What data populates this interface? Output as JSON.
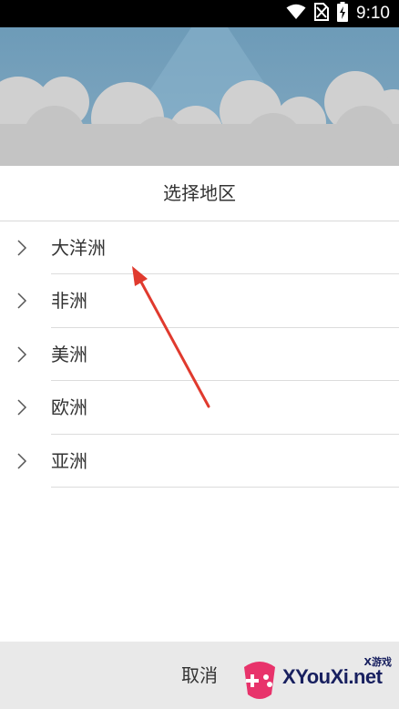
{
  "status_bar": {
    "time": "9:10",
    "icons": [
      "wifi-icon",
      "no-sim-icon",
      "battery-charging-icon"
    ]
  },
  "dialog": {
    "title": "选择地区",
    "regions": [
      {
        "label": "大洋洲",
        "icon": "chevron-right-icon"
      },
      {
        "label": "非洲",
        "icon": "chevron-right-icon"
      },
      {
        "label": "美洲",
        "icon": "chevron-right-icon"
      },
      {
        "label": "欧洲",
        "icon": "chevron-right-icon"
      },
      {
        "label": "亚洲",
        "icon": "chevron-right-icon"
      }
    ],
    "cancel_label": "取消"
  },
  "annotation": {
    "type": "arrow",
    "color": "#e03a2e"
  },
  "watermark": {
    "brand": "XYouXi.net",
    "sub": "X游戏"
  },
  "colors": {
    "status_bar": "#000000",
    "sky": "#7aa3bd",
    "cloud": "#c4c4c4",
    "bottom_bar": "#e9e9e9"
  }
}
